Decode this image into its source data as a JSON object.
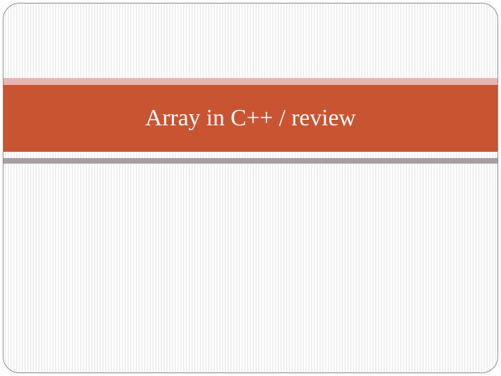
{
  "slide": {
    "title": "Array in C++ / review"
  },
  "colors": {
    "titleBar": "#c85432",
    "accentTop": "#e8b5b0",
    "accentBottom": "#a8a0a0",
    "titleText": "#ffffff"
  }
}
